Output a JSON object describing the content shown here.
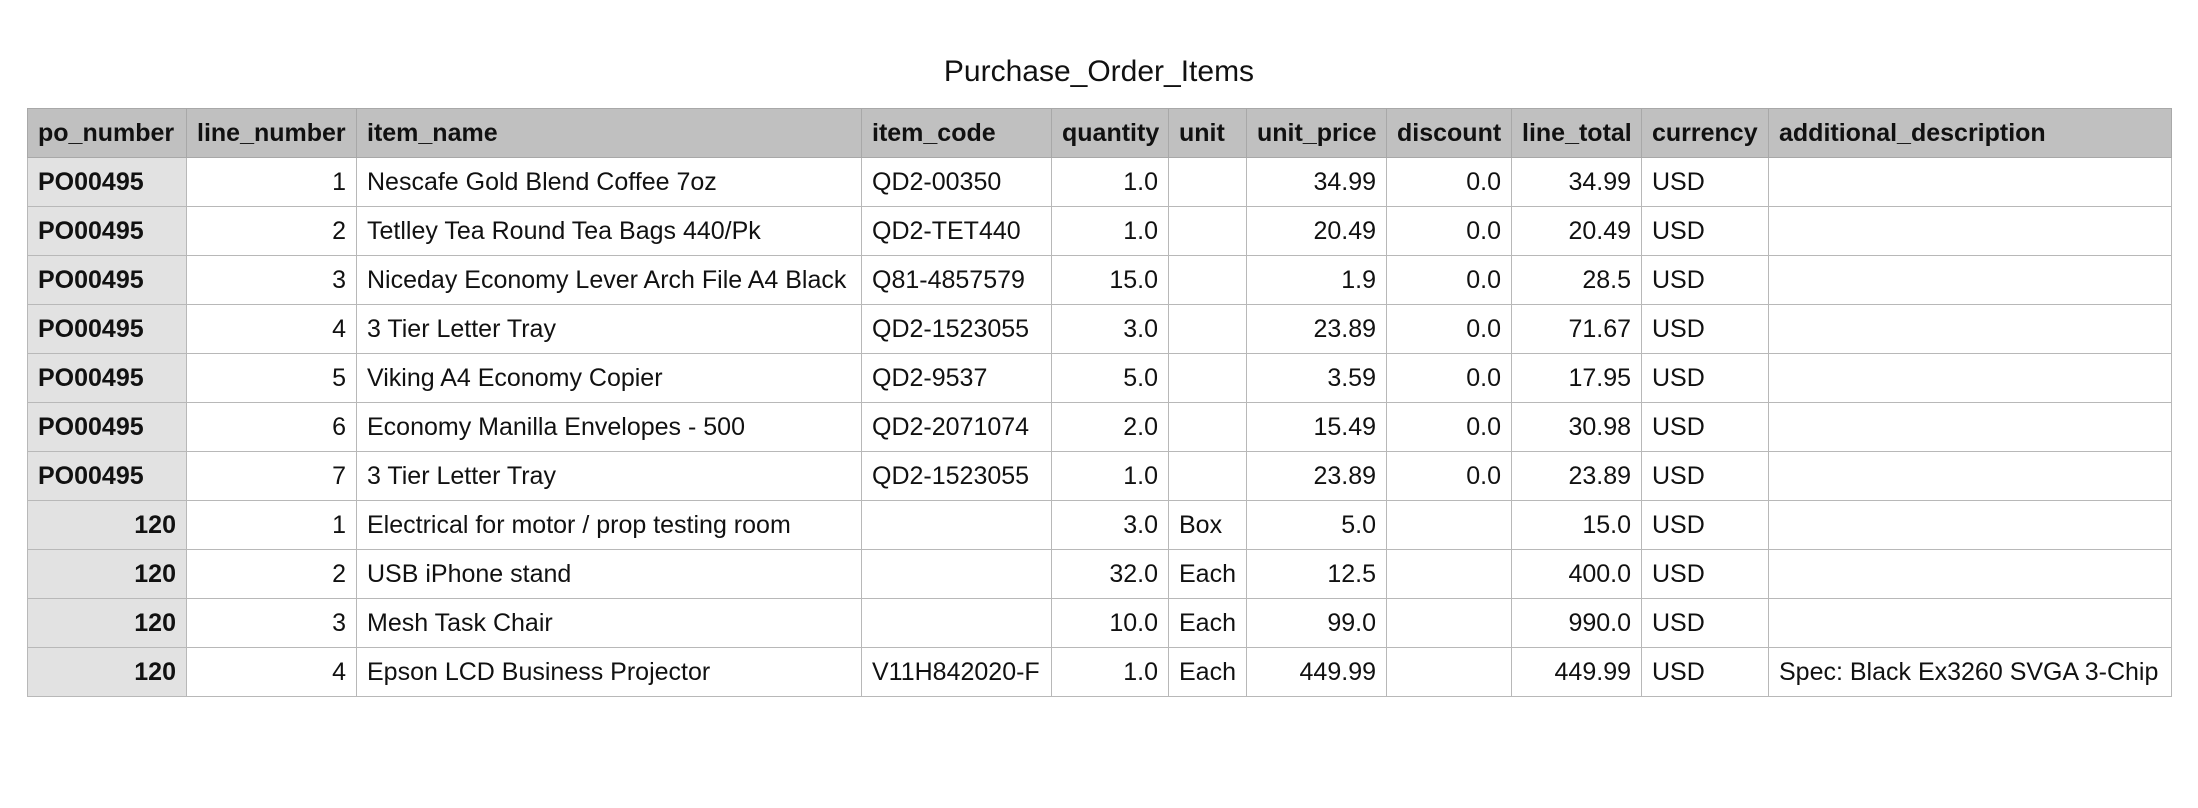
{
  "sheet": {
    "title": "Purchase_Order_Items"
  },
  "table": {
    "columns": [
      "po_number",
      "line_number",
      "item_name",
      "item_code",
      "quantity",
      "unit",
      "unit_price",
      "discount",
      "line_total",
      "currency",
      "additional_description"
    ],
    "rows": [
      [
        "PO00495",
        "1",
        "Nescafe Gold Blend Coffee 7oz",
        "QD2-00350",
        "1.0",
        "",
        "34.99",
        "0.0",
        "34.99",
        "USD",
        ""
      ],
      [
        "PO00495",
        "2",
        "Tetlley Tea Round Tea Bags 440/Pk",
        "QD2-TET440",
        "1.0",
        "",
        "20.49",
        "0.0",
        "20.49",
        "USD",
        ""
      ],
      [
        "PO00495",
        "3",
        "Niceday Economy Lever Arch File A4 Black",
        "Q81-4857579",
        "15.0",
        "",
        "1.9",
        "0.0",
        "28.5",
        "USD",
        ""
      ],
      [
        "PO00495",
        "4",
        "3 Tier Letter Tray",
        "QD2-1523055",
        "3.0",
        "",
        "23.89",
        "0.0",
        "71.67",
        "USD",
        ""
      ],
      [
        "PO00495",
        "5",
        "Viking A4 Economy Copier",
        "QD2-9537",
        "5.0",
        "",
        "3.59",
        "0.0",
        "17.95",
        "USD",
        ""
      ],
      [
        "PO00495",
        "6",
        "Economy Manilla Envelopes - 500",
        "QD2-2071074",
        "2.0",
        "",
        "15.49",
        "0.0",
        "30.98",
        "USD",
        ""
      ],
      [
        "PO00495",
        "7",
        "3 Tier Letter Tray",
        "QD2-1523055",
        "1.0",
        "",
        "23.89",
        "0.0",
        "23.89",
        "USD",
        ""
      ],
      [
        "120",
        "1",
        "Electrical for motor / prop testing room",
        "",
        "3.0",
        "Box",
        "5.0",
        "",
        "15.0",
        "USD",
        ""
      ],
      [
        "120",
        "2",
        "USB iPhone stand",
        "",
        "32.0",
        "Each",
        "12.5",
        "",
        "400.0",
        "USD",
        ""
      ],
      [
        "120",
        "3",
        "Mesh Task Chair",
        "",
        "10.0",
        "Each",
        "99.0",
        "",
        "990.0",
        "USD",
        ""
      ],
      [
        "120",
        "4",
        "Epson LCD Business Projector",
        "V11H842020-F",
        "1.0",
        "Each",
        "449.99",
        "",
        "449.99",
        "USD",
        "Spec: Black Ex3260 SVGA 3-Chip"
      ]
    ]
  }
}
